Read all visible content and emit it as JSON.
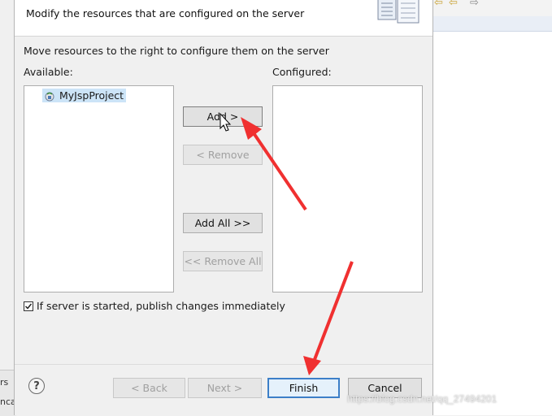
{
  "header": {
    "message": "Modify the resources that are configured on the server"
  },
  "instruction": "Move resources to the right to configure them on the server",
  "available": {
    "label": "Available:",
    "items": [
      {
        "label": "MyJspProject",
        "icon": "web-project-icon"
      }
    ]
  },
  "configured": {
    "label": "Configured:",
    "items": []
  },
  "buttons": {
    "add": "Add >",
    "remove": "< Remove",
    "add_all": "Add All >>",
    "remove_all": "<< Remove All",
    "back": "< Back",
    "next": "Next >",
    "finish": "Finish",
    "cancel": "Cancel"
  },
  "publish_option": {
    "label": "If server is started, publish changes immediately",
    "checked": true
  },
  "help_glyph": "?",
  "background_fragments": {
    "left_text_1": "rs",
    "left_text_2": "nca"
  },
  "watermark": "https://blog.csdn.net/qq_27494201",
  "colors": {
    "annotation_arrow": "#f03030",
    "selection": "#cce4f7",
    "default_button_border": "#3c7fc8"
  }
}
